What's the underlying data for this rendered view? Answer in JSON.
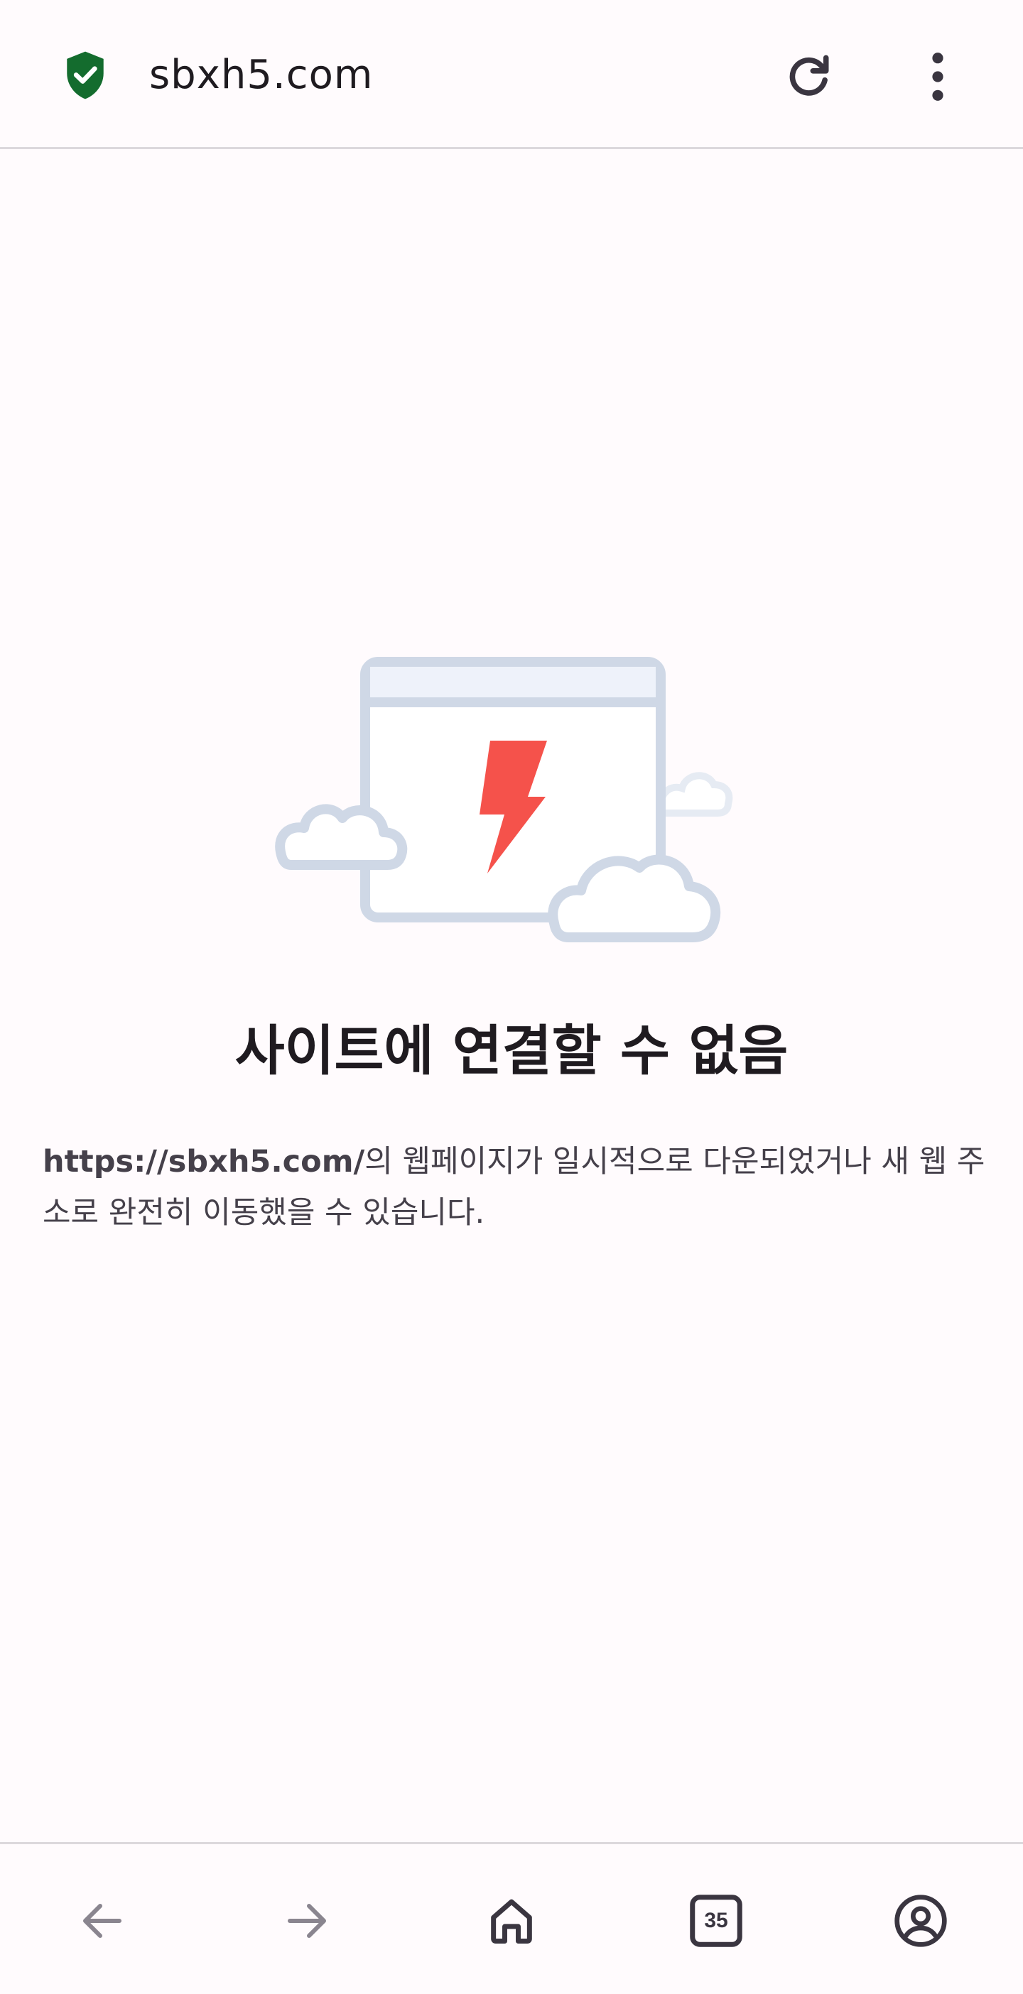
{
  "address_bar": {
    "url": "sbxh5.com",
    "security_icon": "shield-check-icon",
    "reload_icon": "reload-icon",
    "menu_icon": "more-vert-icon"
  },
  "error": {
    "title": "사이트에 연결할 수 없음",
    "url": "https://sbxh5.com/",
    "description": "의 웹페이지가 일시적으로 다운되었거나 새 웹 주소로 완전히 이동했을 수 있습니다."
  },
  "bottom_nav": {
    "back_icon": "arrow-back-icon",
    "forward_icon": "arrow-forward-icon",
    "home_icon": "home-icon",
    "tabs_count": "35",
    "account_icon": "account-circle-icon"
  },
  "colors": {
    "background": "#fffbfd",
    "shield": "#146c2e",
    "bolt": "#f5524b",
    "illustration": "#cfd8e6"
  }
}
